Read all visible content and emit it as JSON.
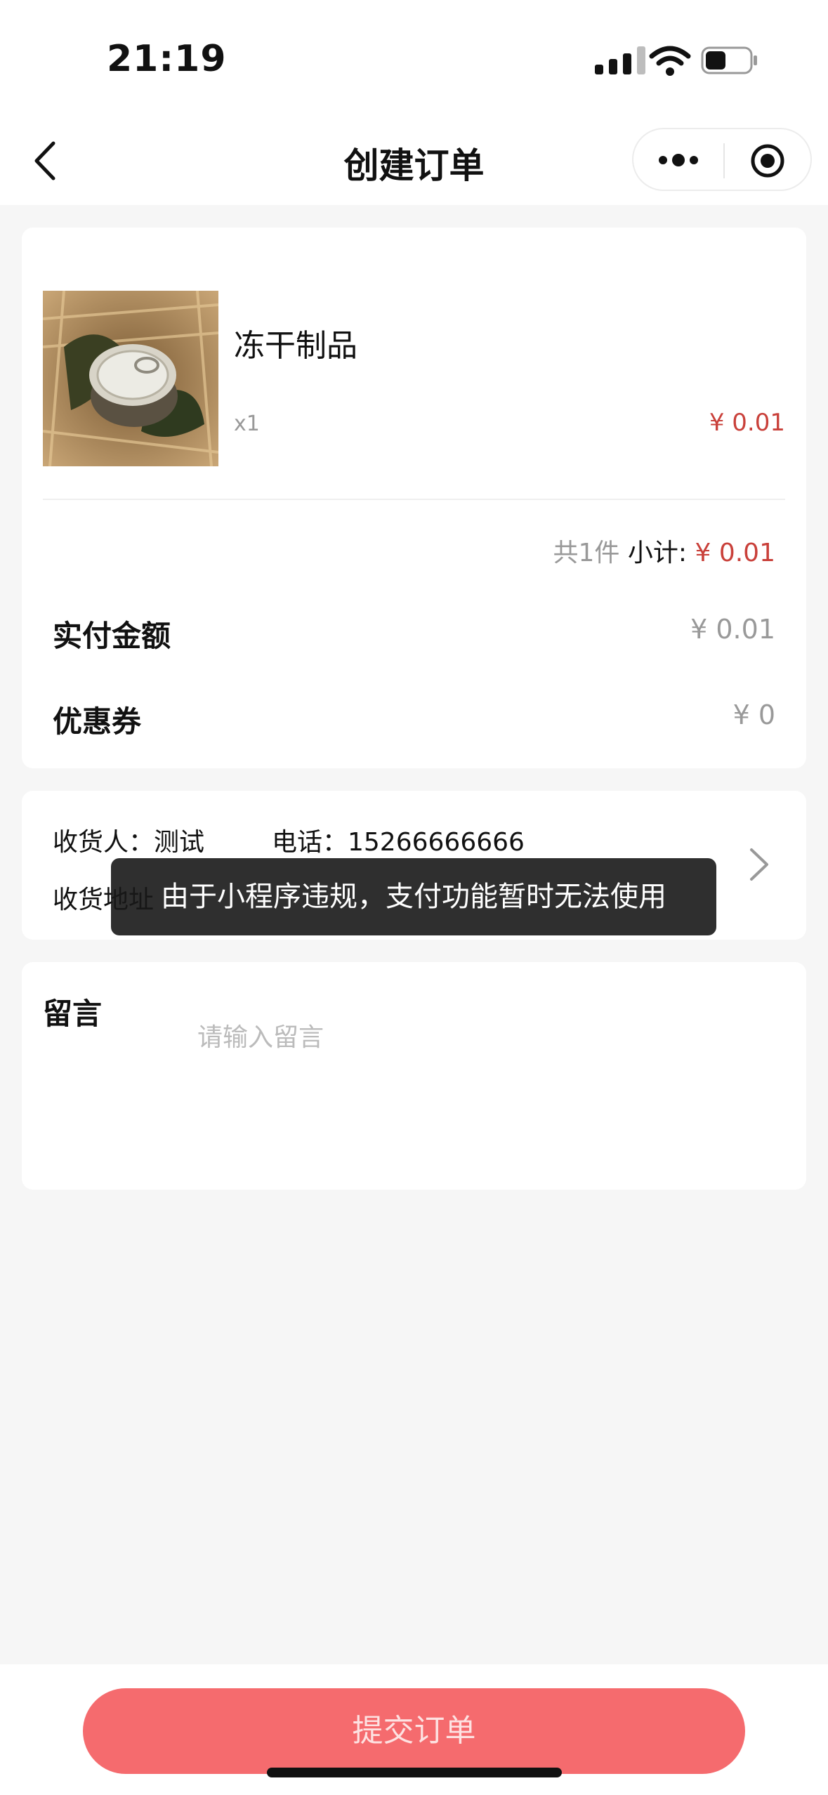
{
  "status_bar": {
    "time": "21:19"
  },
  "nav": {
    "title": "创建订单"
  },
  "product": {
    "name": "冻干制品",
    "quantity": "x1",
    "price": "¥ 0.01"
  },
  "summary": {
    "count_text": "共1件",
    "subtotal_label": "小计:",
    "subtotal_value": "¥ 0.01"
  },
  "payment": {
    "paid_label": "实付金额",
    "paid_value": "¥ 0.01",
    "coupon_label": "优惠券",
    "coupon_value": "¥ 0"
  },
  "shipping": {
    "recipient": "收货人：测试",
    "phone": "电话：15266666666",
    "address_label": "收货地址"
  },
  "memo": {
    "label": "留言",
    "placeholder": "请输入留言"
  },
  "toast": {
    "message": "由于小程序违规，支付功能暂时无法使用"
  },
  "submit": {
    "label": "提交订单"
  },
  "colors": {
    "accent": "#f56b6e",
    "price_red": "#c9403a"
  }
}
